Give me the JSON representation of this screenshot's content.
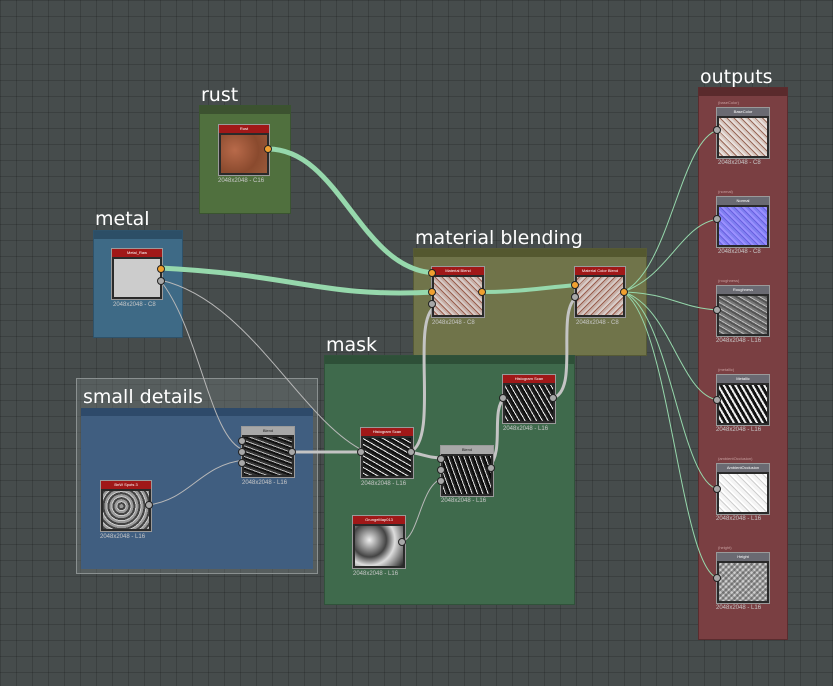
{
  "frames": {
    "rust": {
      "title": "rust",
      "color": "#50703e"
    },
    "metal": {
      "title": "metal",
      "color": "#3e6a86"
    },
    "material_blending": {
      "title": "material blending",
      "color": "#70744a"
    },
    "mask": {
      "title": "mask",
      "color": "#3f6a4c"
    },
    "small_details": {
      "title": "small details",
      "color": "#405e80"
    },
    "outputs": {
      "title": "outputs",
      "color": "#7a3f42"
    }
  },
  "nodes": {
    "rust": {
      "title": "Rust",
      "size": "2048x2048 - C16"
    },
    "metal_raw": {
      "title": "Metal_Raw",
      "size": "2048x2048 - C8"
    },
    "material_blend": {
      "title": "Material Blend",
      "size": "2048x2048 - C8"
    },
    "material_color_blend": {
      "title": "Material Color Blend",
      "size": "2048x2048 - C8"
    },
    "histogram_scan_top": {
      "title": "Histogram Scan",
      "size": "2048x2048 - L16"
    },
    "histogram_scan_mid": {
      "title": "Histogram Scan",
      "size": "2048x2048 - L16"
    },
    "blend_mask": {
      "title": "Blend",
      "size": "2048x2048 - L16"
    },
    "grunge_map": {
      "title": "GrungeMap013",
      "size": "2048x2048 - L16"
    },
    "blend_details": {
      "title": "Blend",
      "size": "2048x2048 - L16"
    },
    "bnw_spots": {
      "title": "BnW Spots 3",
      "size": "2048x2048 - L16"
    }
  },
  "outputs": [
    {
      "id": "(baseColor)",
      "title": "BaseColor",
      "size": "2048x2048 - C8"
    },
    {
      "id": "(normal)",
      "title": "Normal",
      "size": "2048x2048 - C8"
    },
    {
      "id": "(roughness)",
      "title": "Roughness",
      "size": "2048x2048 - L16"
    },
    {
      "id": "(metallic)",
      "title": "Metallic",
      "size": "2048x2048 - L16"
    },
    {
      "id": "(ambientOcclusion)",
      "title": "AmbientOcclusion",
      "size": "2048x2048 - L16"
    },
    {
      "id": "(height)",
      "title": "Height",
      "size": "2048x2048 - L16"
    }
  ],
  "colors": {
    "link_material": "#96d8ac",
    "link_mask": "#c4c4c4",
    "node_header": "#a01818",
    "output_node_header": "#6a6a72",
    "port_material": "#f0a030",
    "port_grayscale": "#a8a8a8"
  }
}
